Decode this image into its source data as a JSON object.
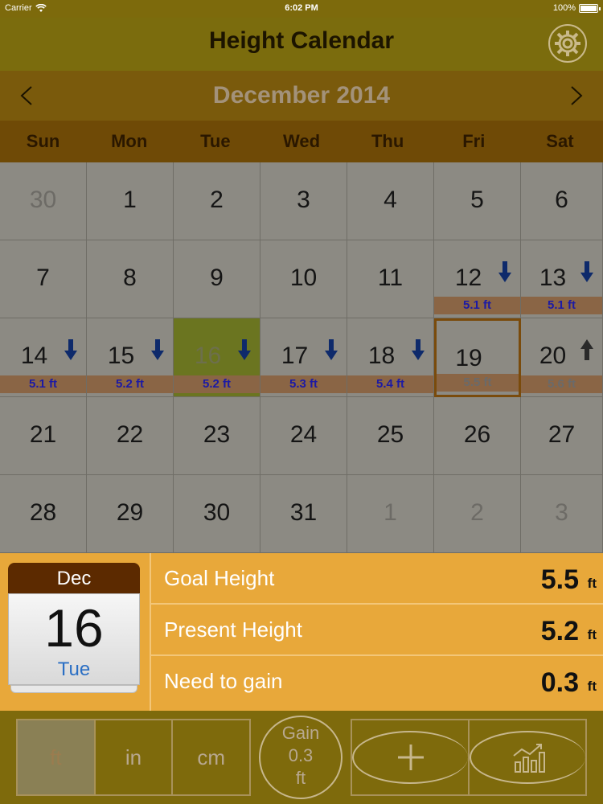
{
  "status_bar": {
    "carrier": "Carrier",
    "time": "6:02 PM",
    "battery": "100%"
  },
  "header": {
    "title": "Height Calendar",
    "settings_icon": "gear-icon"
  },
  "month_nav": {
    "month": "December 2014",
    "prev_icon": "chevron-left-icon",
    "next_icon": "chevron-right-icon"
  },
  "weekdays": [
    "Sun",
    "Mon",
    "Tue",
    "Wed",
    "Thu",
    "Fri",
    "Sat"
  ],
  "calendar": {
    "weeks": [
      [
        {
          "day": "30",
          "other": true
        },
        {
          "day": "1"
        },
        {
          "day": "2"
        },
        {
          "day": "3"
        },
        {
          "day": "4"
        },
        {
          "day": "5"
        },
        {
          "day": "6"
        }
      ],
      [
        {
          "day": "7"
        },
        {
          "day": "8"
        },
        {
          "day": "9"
        },
        {
          "day": "10"
        },
        {
          "day": "11"
        },
        {
          "day": "12",
          "height": "5.1 ft",
          "trend": "down"
        },
        {
          "day": "13",
          "height": "5.1 ft",
          "trend": "down"
        }
      ],
      [
        {
          "day": "14",
          "height": "5.1 ft",
          "trend": "down"
        },
        {
          "day": "15",
          "height": "5.2 ft",
          "trend": "down"
        },
        {
          "day": "16",
          "height": "5.2 ft",
          "trend": "down",
          "today": true
        },
        {
          "day": "17",
          "height": "5.3 ft",
          "trend": "down"
        },
        {
          "day": "18",
          "height": "5.4 ft",
          "trend": "down"
        },
        {
          "day": "19",
          "height": "5.5 ft",
          "selected": true,
          "muted": true
        },
        {
          "day": "20",
          "height": "5.6 ft",
          "trend": "up",
          "muted": true
        }
      ],
      [
        {
          "day": "21"
        },
        {
          "day": "22"
        },
        {
          "day": "23"
        },
        {
          "day": "24"
        },
        {
          "day": "25"
        },
        {
          "day": "26"
        },
        {
          "day": "27"
        }
      ],
      [
        {
          "day": "28"
        },
        {
          "day": "29"
        },
        {
          "day": "30"
        },
        {
          "day": "31"
        },
        {
          "day": "1",
          "other": true
        },
        {
          "day": "2",
          "other": true
        },
        {
          "day": "3",
          "other": true
        }
      ]
    ]
  },
  "date_card": {
    "month": "Dec",
    "day": "16",
    "weekday": "Tue"
  },
  "stats": [
    {
      "label": "Goal Height",
      "value": "5.5",
      "unit": "ft"
    },
    {
      "label": "Present Height",
      "value": "5.2",
      "unit": "ft"
    },
    {
      "label": "Need to gain",
      "value": "0.3",
      "unit": "ft"
    }
  ],
  "units": [
    {
      "label": "ft",
      "active": true
    },
    {
      "label": "in",
      "active": false
    },
    {
      "label": "cm",
      "active": false
    }
  ],
  "gain": {
    "line1": "Gain",
    "line2": "0.3",
    "line3": "ft"
  },
  "actions": {
    "add_icon": "plus-icon",
    "chart_icon": "chart-icon"
  },
  "colors": {
    "down_arrow": "#0e2a6b",
    "up_arrow": "#2a2a2a",
    "height_text": "#1c1aa5"
  }
}
